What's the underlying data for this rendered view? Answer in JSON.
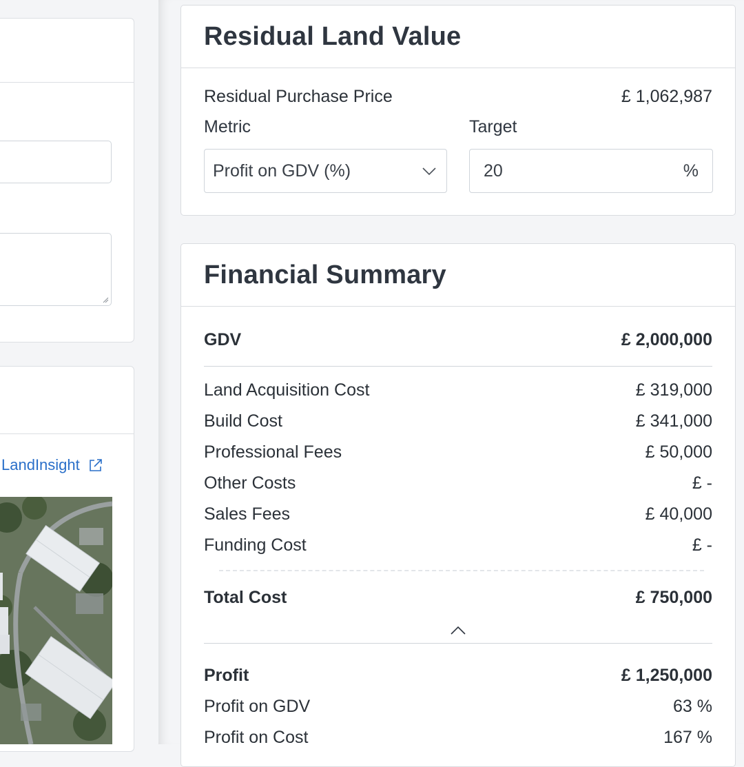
{
  "left_panel": {
    "landinsight_link": "LandInsight",
    "icons": {
      "external_link": "external-link-icon",
      "resize": "resize-handle-icon"
    }
  },
  "residual": {
    "title": "Residual Land Value",
    "purchase_label": "Residual Purchase Price",
    "purchase_value": "£ 1,062,987",
    "metric_label": "Metric",
    "metric_value": "Profit on GDV (%)",
    "target_label": "Target",
    "target_value": "20",
    "target_unit": "%"
  },
  "summary": {
    "title": "Financial Summary",
    "gdv_label": "GDV",
    "gdv_value": "£ 2,000,000",
    "costs": [
      {
        "label": "Land Acquisition Cost",
        "value": "£ 319,000"
      },
      {
        "label": "Build Cost",
        "value": "£ 341,000"
      },
      {
        "label": "Professional Fees",
        "value": "£ 50,000"
      },
      {
        "label": "Other Costs",
        "value": "£ -"
      },
      {
        "label": "Sales Fees",
        "value": "£ 40,000"
      },
      {
        "label": "Funding Cost",
        "value": "£ -"
      }
    ],
    "total_cost_label": "Total Cost",
    "total_cost_value": "£ 750,000",
    "profit_label": "Profit",
    "profit_value": "£ 1,250,000",
    "profit_gdv_label": "Profit on GDV",
    "profit_gdv_value": "63 %",
    "profit_cost_label": "Profit on Cost",
    "profit_cost_value": "167 %"
  },
  "colors": {
    "link": "#2a6fc9",
    "text": "#2b3138",
    "border": "#d9dce0"
  }
}
